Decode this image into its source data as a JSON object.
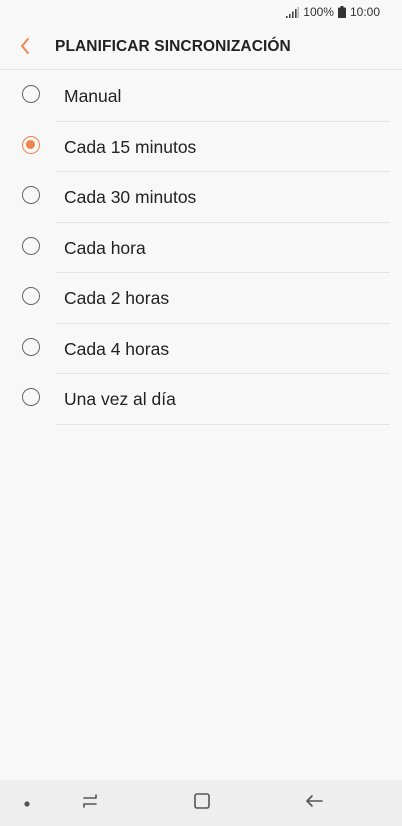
{
  "status_bar": {
    "battery": "100%",
    "time": "10:00",
    "icons": [
      "signal-icon",
      "battery-icon"
    ]
  },
  "header": {
    "title": "PLANIFICAR SINCRONIZACIÓN",
    "back_icon": "chevron-left-icon"
  },
  "options": [
    {
      "label": "Manual",
      "selected": false
    },
    {
      "label": "Cada 15 minutos",
      "selected": true
    },
    {
      "label": "Cada 30 minutos",
      "selected": false
    },
    {
      "label": "Cada hora",
      "selected": false
    },
    {
      "label": "Cada 2 horas",
      "selected": false
    },
    {
      "label": "Cada 4 horas",
      "selected": false
    },
    {
      "label": "Una vez al día",
      "selected": false
    }
  ],
  "nav_bar": {
    "icons": [
      "dot-icon",
      "recent-apps-icon",
      "home-icon",
      "back-arrow-icon"
    ]
  },
  "colors": {
    "accent": "#f2844b",
    "background": "#f8f8f8",
    "nav_background": "#eeeeee"
  }
}
